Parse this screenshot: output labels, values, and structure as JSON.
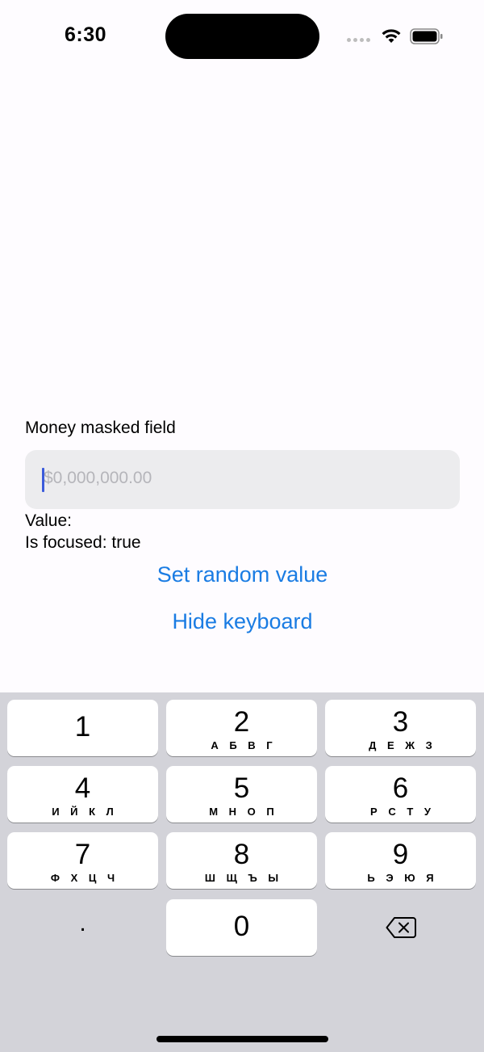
{
  "status_bar": {
    "time": "6:30"
  },
  "form": {
    "field_label": "Money masked field",
    "input_value": "",
    "input_placeholder": "$0,000,000.00",
    "value_label": "Value:",
    "focused_label": "Is focused: true",
    "set_random_label": "Set random value",
    "hide_keyboard_label": "Hide keyboard"
  },
  "keyboard": {
    "keys": [
      {
        "digit": "1",
        "letters": ""
      },
      {
        "digit": "2",
        "letters": "А Б В Г"
      },
      {
        "digit": "3",
        "letters": "Д Е Ж З"
      },
      {
        "digit": "4",
        "letters": "И Й К Л"
      },
      {
        "digit": "5",
        "letters": "М Н О П"
      },
      {
        "digit": "6",
        "letters": "Р С Т У"
      },
      {
        "digit": "7",
        "letters": "Ф Х Ц Ч"
      },
      {
        "digit": "8",
        "letters": "Ш Щ Ъ Ы"
      },
      {
        "digit": "9",
        "letters": "Ь Э Ю Я"
      }
    ],
    "zero": "0",
    "dot": "."
  },
  "colors": {
    "accent": "#1a7ce3",
    "caret": "#3b5bdb",
    "keyboard_bg": "#d3d3d9",
    "input_bg": "#ececee"
  },
  "icons": {
    "wifi": "wifi-icon",
    "battery": "battery-icon",
    "backspace": "backspace-icon"
  }
}
